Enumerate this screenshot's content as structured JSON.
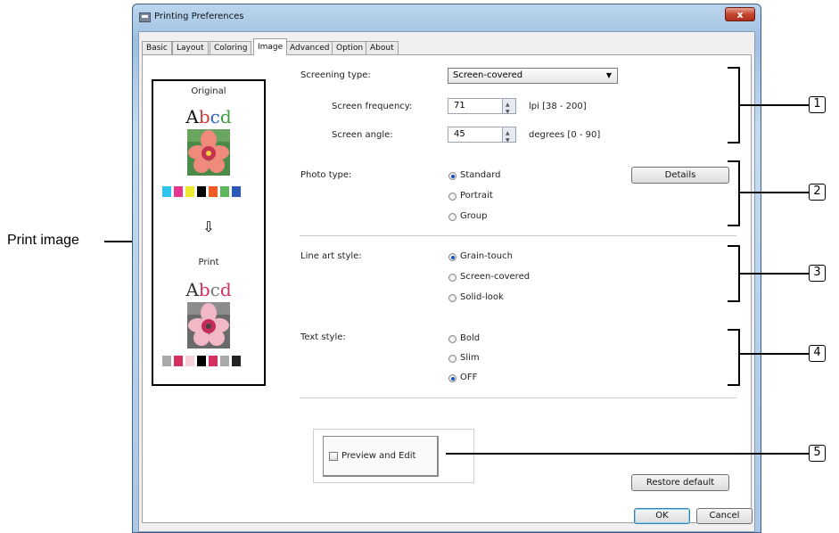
{
  "window": {
    "title": "Printing Preferences",
    "close_glyph": "x"
  },
  "tabs": [
    {
      "label": "Basic"
    },
    {
      "label": "Layout"
    },
    {
      "label": "Coloring"
    },
    {
      "label": "Image"
    },
    {
      "label": "Advanced"
    },
    {
      "label": "Option"
    },
    {
      "label": "About"
    }
  ],
  "active_tab": "Image",
  "preview": {
    "original_label": "Original",
    "print_label": "Print",
    "sample_text": "Abcd",
    "arrow_glyph": "⇩",
    "original_swatches": [
      "#2ec4ef",
      "#e8358f",
      "#efe934",
      "#000000",
      "#ee5c24",
      "#5cb85c",
      "#2b57b5"
    ],
    "print_swatches": [
      "#a9a9a9",
      "#d43060",
      "#f7cfd9",
      "#000000",
      "#d43060",
      "#a9a9a9",
      "#222222"
    ]
  },
  "screening": {
    "label": "Screening type:",
    "value": "Screen-covered",
    "frequency_label": "Screen frequency:",
    "frequency_value": "71",
    "frequency_range": "lpi [38 - 200]",
    "angle_label": "Screen angle:",
    "angle_value": "45",
    "angle_range": "degrees [0 - 90]"
  },
  "photo": {
    "label": "Photo type:",
    "options": [
      "Standard",
      "Portrait",
      "Group"
    ],
    "selected": "Standard",
    "details_button": "Details"
  },
  "line_art": {
    "label": "Line art style:",
    "options": [
      "Grain-touch",
      "Screen-covered",
      "Solid-look"
    ],
    "selected": "Grain-touch"
  },
  "text_style": {
    "label": "Text style:",
    "options": [
      "Bold",
      "Slim",
      "OFF"
    ],
    "selected": "OFF"
  },
  "preview_edit": {
    "label": "Preview and Edit",
    "checked": false
  },
  "buttons": {
    "restore": "Restore default",
    "ok": "OK",
    "cancel": "Cancel"
  },
  "annotations": {
    "print_image_label": "Print image",
    "callouts": [
      "1",
      "2",
      "3",
      "4",
      "5"
    ]
  },
  "colors": {
    "radio_selected": "#1e4fb5",
    "close_button": "#c5452f",
    "window_frame": "#9ebfe2"
  }
}
